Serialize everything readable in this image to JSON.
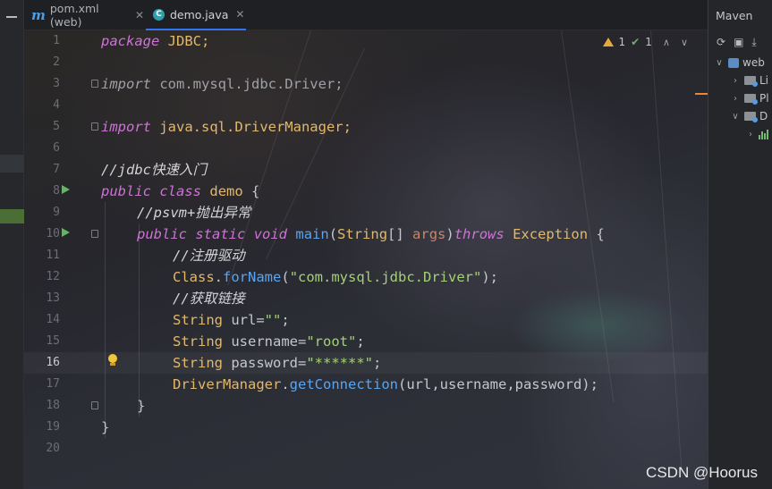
{
  "tabs": [
    {
      "label": "pom.xml (web)",
      "icon": "maven-m-icon",
      "active": false
    },
    {
      "label": "demo.java",
      "icon": "java-class-icon",
      "active": true
    }
  ],
  "inspection": {
    "warnings": "1",
    "weak_warnings": "1"
  },
  "editor": {
    "current_line": 16,
    "line_numbers": [
      "1",
      "2",
      "3",
      "4",
      "5",
      "6",
      "7",
      "8",
      "9",
      "10",
      "11",
      "12",
      "13",
      "14",
      "15",
      "16",
      "17",
      "18",
      "19",
      "20"
    ]
  },
  "code": {
    "l1": {
      "kw": "package",
      "rest": " JDBC;"
    },
    "l3": {
      "kw": "import",
      "rest": " com.mysql.jdbc.Driver;"
    },
    "l5": {
      "kw": "import",
      "rest": " java.sql.DriverManager;"
    },
    "l7": {
      "comment_prefix": "//",
      "comment": "jdbc快速入门"
    },
    "l8": {
      "kw1": "public",
      "kw2": "class",
      "name": "demo",
      "brace": "{"
    },
    "l9": {
      "comment_prefix": "//",
      "comment": "psvm+抛出异常"
    },
    "l10": {
      "kw1": "public",
      "kw2": "static",
      "kw3": "void",
      "fn": "main",
      "type": "String",
      "arr": "[]",
      "param": "args",
      "throws": "throws",
      "ex": "Exception",
      "brace": "{"
    },
    "l11": {
      "comment_prefix": "//",
      "comment": "注册驱动"
    },
    "l12": {
      "cls": "Class",
      "fn": "forName",
      "str": "\"com.mysql.jdbc.Driver\""
    },
    "l13": {
      "comment_prefix": "//",
      "comment": "获取链接"
    },
    "l14": {
      "type": "String",
      "var": " url=",
      "str": "\"\"",
      "end": ";"
    },
    "l15": {
      "type": "String",
      "var": " username=",
      "str": "\"root\"",
      "end": ";"
    },
    "l16": {
      "type": "String",
      "var": " password=",
      "str": "\"******\"",
      "end": ";"
    },
    "l17": {
      "cls": "DriverManager",
      "fn": "getConnection",
      "args": "(url,username,password);"
    },
    "l18": {
      "brace": "}"
    },
    "l19": {
      "brace": "}"
    }
  },
  "maven": {
    "title": "Maven",
    "toolbar": [
      "refresh-icon",
      "add-folder-icon",
      "download-icon"
    ],
    "tree": [
      {
        "label": "web",
        "expanded": true
      },
      {
        "label": "Li",
        "expanded": false
      },
      {
        "label": "Pl",
        "expanded": false
      },
      {
        "label": "D",
        "expanded": true
      },
      {
        "label": "",
        "expanded": false
      }
    ]
  },
  "watermark": "CSDN @Hoorus"
}
